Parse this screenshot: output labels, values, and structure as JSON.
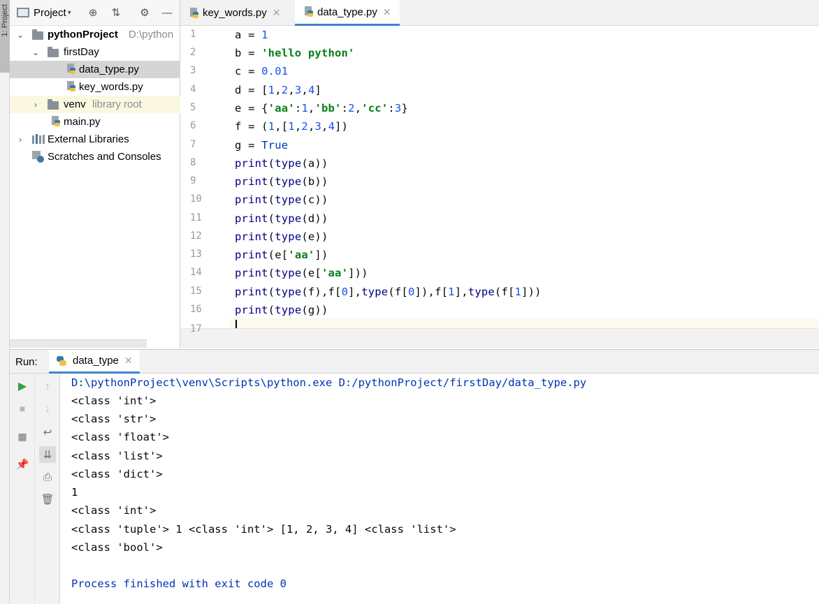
{
  "side_stripe": {
    "project_tab_label": "1: Project"
  },
  "project_panel": {
    "title": "Project",
    "tree": [
      {
        "label": "pythonProject",
        "hint": "D:\\python",
        "type": "root-folder"
      },
      {
        "label": "firstDay",
        "hint": "",
        "type": "folder"
      },
      {
        "label": "data_type.py",
        "hint": "",
        "type": "py-file"
      },
      {
        "label": "key_words.py",
        "hint": "",
        "type": "py-file"
      },
      {
        "label": "venv",
        "hint": "library root",
        "type": "folder"
      },
      {
        "label": "main.py",
        "hint": "",
        "type": "py-file"
      },
      {
        "label": "External Libraries",
        "hint": "",
        "type": "libraries"
      },
      {
        "label": "Scratches and Consoles",
        "hint": "",
        "type": "scratches"
      }
    ]
  },
  "editor": {
    "tabs": [
      {
        "label": "key_words.py",
        "active": false
      },
      {
        "label": "data_type.py",
        "active": true
      }
    ],
    "line_numbers": [
      "1",
      "2",
      "3",
      "4",
      "5",
      "6",
      "7",
      "8",
      "9",
      "10",
      "11",
      "12",
      "13",
      "14",
      "15",
      "16",
      "17"
    ],
    "code_lines": [
      "a = 1",
      "b = 'hello python'",
      "c = 0.01",
      "d = [1,2,3,4]",
      "e = {'aa':1,'bb':2,'cc':3}",
      "f = (1,[1,2,3,4])",
      "g = True",
      "print(type(a))",
      "print(type(b))",
      "print(type(c))",
      "print(type(d))",
      "print(type(e))",
      "print(e['aa'])",
      "print(type(e['aa']))",
      "print(type(f),f[0],type(f[0]),f[1],type(f[1]))",
      "print(type(g))",
      ""
    ]
  },
  "run_panel": {
    "label": "Run:",
    "tab_label": "data_type",
    "output": [
      "D:\\pythonProject\\venv\\Scripts\\python.exe D:/pythonProject/firstDay/data_type.py",
      "<class 'int'>",
      "<class 'str'>",
      "<class 'float'>",
      "<class 'list'>",
      "<class 'dict'>",
      "1",
      "<class 'int'>",
      "<class 'tuple'> 1 <class 'int'> [1, 2, 3, 4] <class 'list'>",
      "<class 'bool'>",
      "",
      "Process finished with exit code 0"
    ]
  },
  "colors": {
    "keyword": "#0033b3",
    "number": "#1750eb",
    "string": "#067d17",
    "builtin": "#000080",
    "run_icon": "#3ca03c",
    "tab_underline": "#4083c9"
  }
}
